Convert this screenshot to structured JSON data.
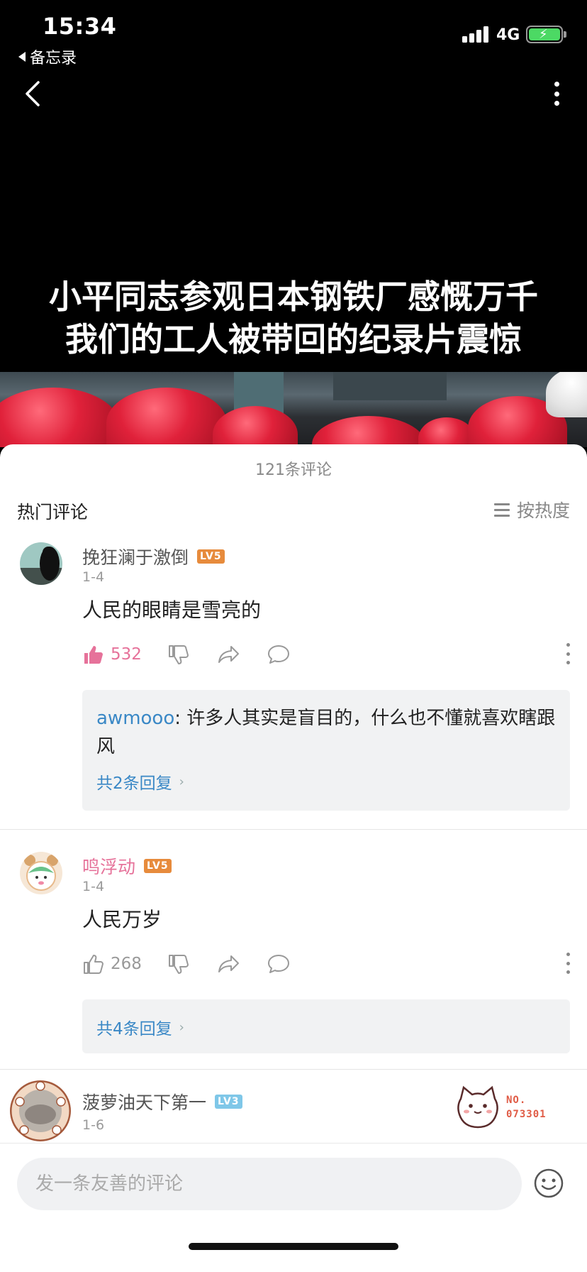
{
  "status_bar": {
    "time": "15:34",
    "back_app": "备忘录",
    "network": "4G",
    "battery_charging": true
  },
  "video": {
    "caption_line1": "小平同志参观日本钢铁厂感慨万千",
    "caption_line2": "我们的工人被带回的纪录片震惊"
  },
  "comments_panel": {
    "count_label": "121条评论",
    "section_title": "热门评论",
    "sort_label": "按热度",
    "comments": [
      {
        "username": "挽狂澜于激倒",
        "level": "LV5",
        "date": "1-4",
        "text": "人民的眼睛是雪亮的",
        "likes": "532",
        "liked": true,
        "reply_user": "awmooo",
        "reply_text": ": 许多人其实是盲目的，什么也不懂就喜欢瞎跟风",
        "reply_more": "共2条回复"
      },
      {
        "username": "鸣浮动",
        "level": "LV5",
        "date": "1-4",
        "text": "人民万岁",
        "likes": "268",
        "liked": false,
        "reply_more": "共4条回复"
      },
      {
        "username": "菠萝油天下第一",
        "level": "LV3",
        "date": "1-6",
        "badge_text_1": "NO.",
        "badge_text_2": "073301"
      }
    ]
  },
  "input": {
    "placeholder": "发一条友善的评论"
  },
  "colors": {
    "accent_pink": "#e6729a",
    "link_blue": "#3a88c6",
    "level_orange": "#e78b3c",
    "level_blue": "#7fc7e8"
  },
  "icons": [
    "chevron-left-icon",
    "more-vertical-icon",
    "thumb-up-icon",
    "thumb-down-icon",
    "share-icon",
    "comment-bubble-icon",
    "sort-lines-icon",
    "emoji-icon",
    "chevron-right-icon"
  ]
}
